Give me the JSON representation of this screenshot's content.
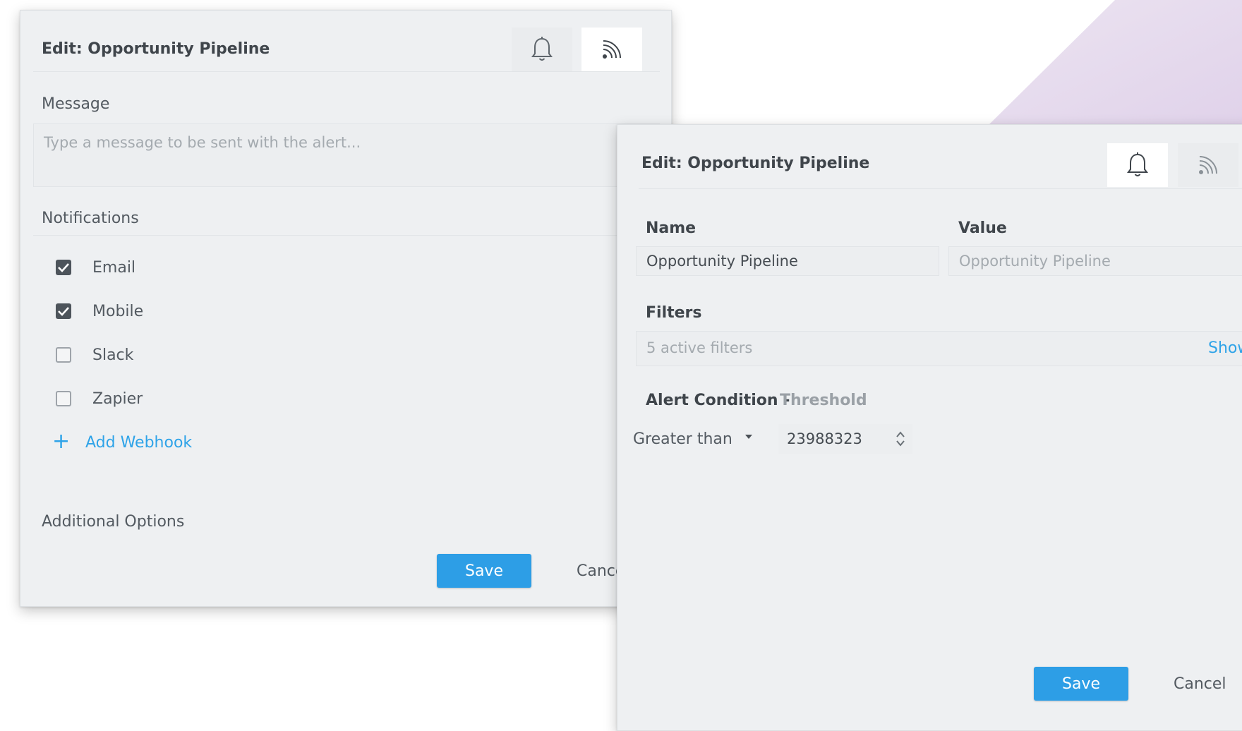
{
  "left_panel": {
    "title": "Edit: Opportunity Pipeline",
    "message_label": "Message",
    "message_placeholder": "Type a message to be sent with the alert...",
    "notifications_label": "Notifications",
    "channels": [
      {
        "label": "Email",
        "checked": true
      },
      {
        "label": "Mobile",
        "checked": true
      },
      {
        "label": "Slack",
        "checked": false
      },
      {
        "label": "Zapier",
        "checked": false
      }
    ],
    "add_webhook_label": "Add Webhook",
    "additional_options_label": "Additional Options",
    "save_label": "Save",
    "cancel_label": "Cancel"
  },
  "right_panel": {
    "title": "Edit: Opportunity Pipeline",
    "name_label": "Name",
    "value_label": "Value",
    "name_value": "Opportunity Pipeline",
    "value_placeholder": "Opportunity Pipeline",
    "filters_label": "Filters",
    "filters_summary": "5 active filters",
    "filters_show_label": "Show",
    "alert_condition_label": "Alert Condition -",
    "alert_condition_type": "Threshold",
    "comparator": "Greater than",
    "threshold_value": "23988323",
    "save_label": "Save",
    "cancel_label": "Cancel"
  },
  "colors": {
    "accent": "#2d9ee6",
    "link": "#2ea3e8",
    "panel_bg": "#eef0f2",
    "decor_purple": "#e7dcee"
  },
  "icons": [
    "bell-icon",
    "rss-feed-icon",
    "checkbox-checked-icon",
    "plus-icon",
    "caret-down-icon",
    "stepper-icon"
  ]
}
